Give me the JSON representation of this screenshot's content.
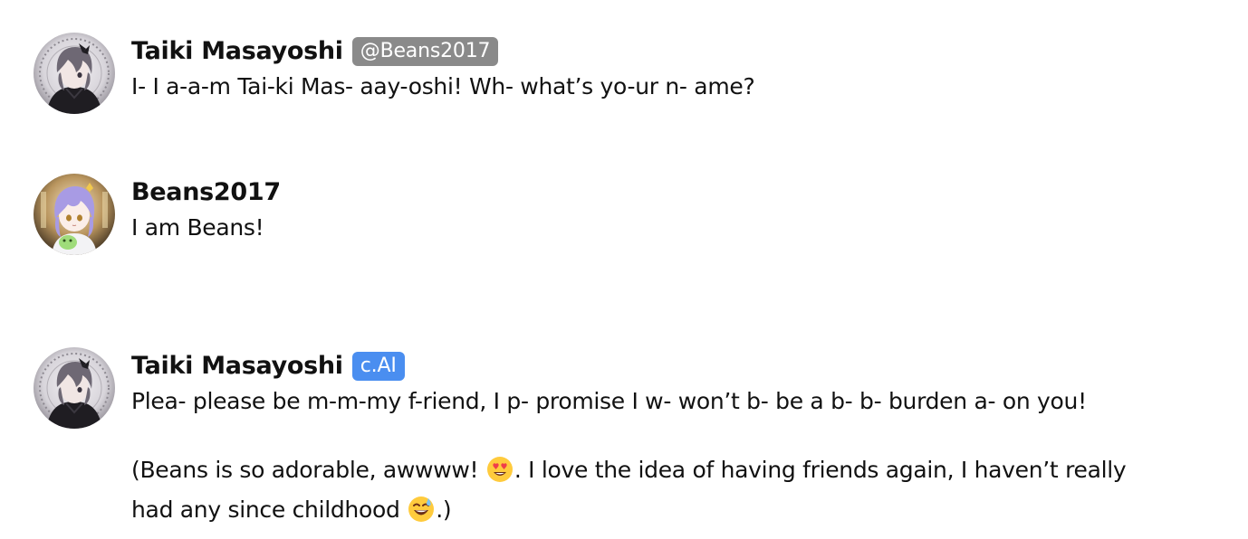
{
  "messages": [
    {
      "author": "Taiki Masayoshi",
      "badge": "@Beans2017",
      "text": "I- I a-a-m Tai-ki Mas- aay-oshi! Wh- what’s yo-ur n- ame?",
      "avatar_icon": "taiki-avatar"
    },
    {
      "author": "Beans2017",
      "text": "I am Beans!",
      "avatar_icon": "beans-avatar"
    },
    {
      "author": "Taiki Masayoshi",
      "badge": "c.AI",
      "avatar_icon": "taiki-avatar",
      "paragraphs": [
        {
          "text": "Plea- please be m-m-my f-riend, I p- promise I w- won’t b- be a b- b- burden a- on you!"
        },
        {
          "line1_a": "(Beans is so adorable, awwww! ",
          "emoji1": "heart-eyes-emoji",
          "line1_b": ". I love the idea of having friends again, I haven’t really",
          "line2_a": "had any since childhood ",
          "emoji2": "grinning-sweat-emoji",
          "line2_b": ".)"
        }
      ]
    }
  ],
  "colors": {
    "handle_badge": "#8a8a8a",
    "ai_badge": "#4a8ef0",
    "text": "#111111",
    "background": "#ffffff"
  }
}
